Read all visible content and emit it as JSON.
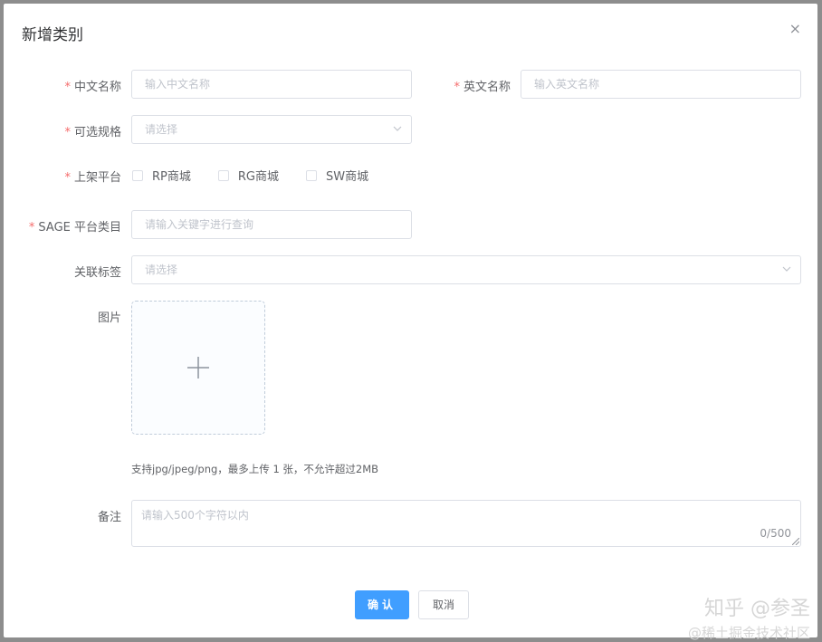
{
  "dialog": {
    "title": "新增类别",
    "close_glyph": "×"
  },
  "form": {
    "required_mark": "*",
    "cn_name": {
      "label": "中文名称",
      "placeholder": "输入中文名称"
    },
    "en_name": {
      "label": "英文名称",
      "placeholder": "输入英文名称"
    },
    "spec": {
      "label": "可选规格",
      "placeholder": "请选择"
    },
    "platform": {
      "label": "上架平台",
      "options": [
        {
          "label": "RP商城",
          "checked": false
        },
        {
          "label": "RG商城",
          "checked": false
        },
        {
          "label": "SW商城",
          "checked": false
        }
      ]
    },
    "sage": {
      "label": "SAGE 平台类目",
      "placeholder": "请输入关键字进行查询"
    },
    "tags": {
      "label": "关联标签",
      "placeholder": "请选择"
    },
    "image": {
      "label": "图片",
      "tip": "支持jpg/jpeg/png，最多上传 1 张，不允许超过2MB"
    },
    "remark": {
      "label": "备注",
      "placeholder": "请输入500个字符以内",
      "counter": "0/500"
    }
  },
  "footer": {
    "confirm_label": "确认",
    "cancel_label": "取消"
  },
  "watermark": {
    "line1": "知乎 @参圣",
    "line2": "@稀土掘金技术社区"
  },
  "colors": {
    "primary": "#409eff",
    "border": "#dcdfe6",
    "required": "#f56c6c",
    "overlay": "#8d8d8d"
  }
}
